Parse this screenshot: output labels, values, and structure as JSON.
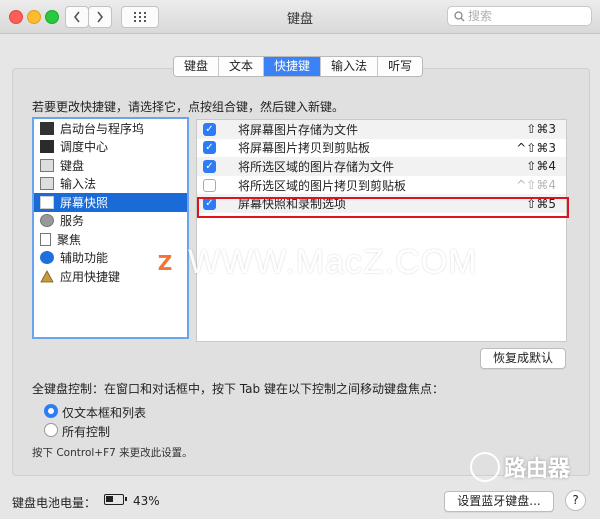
{
  "window": {
    "title": "键盘"
  },
  "search": {
    "placeholder": "搜索"
  },
  "tabs": [
    {
      "label": "键盘",
      "active": false
    },
    {
      "label": "文本",
      "active": false
    },
    {
      "label": "快捷键",
      "active": true
    },
    {
      "label": "输入法",
      "active": false
    },
    {
      "label": "听写",
      "active": false
    }
  ],
  "instruction": "若要更改快捷键，请选择它，点按组合键，然后键入新键。",
  "categories": [
    {
      "label": "启动台与程序坞",
      "icon": "launchpad-icon"
    },
    {
      "label": "调度中心",
      "icon": "mission-control-icon"
    },
    {
      "label": "键盘",
      "icon": "keyboard-icon"
    },
    {
      "label": "输入法",
      "icon": "input-source-icon"
    },
    {
      "label": "屏幕快照",
      "icon": "screenshot-icon",
      "selected": true
    },
    {
      "label": "服务",
      "icon": "gear-icon"
    },
    {
      "label": "聚焦",
      "icon": "spotlight-icon"
    },
    {
      "label": "辅助功能",
      "icon": "accessibility-icon"
    },
    {
      "label": "应用快捷键",
      "icon": "app-shortcut-icon"
    }
  ],
  "shortcuts": [
    {
      "label": "将屏幕图片存储为文件",
      "keys": "⇧⌘3",
      "checked": true
    },
    {
      "label": "将屏幕图片拷贝到剪贴板",
      "keys": "^⇧⌘3",
      "checked": true
    },
    {
      "label": "将所选区域的图片存储为文件",
      "keys": "⇧⌘4",
      "checked": true
    },
    {
      "label": "将所选区域的图片拷贝到剪贴板",
      "keys": "^⇧⌘4",
      "checked": false
    },
    {
      "label": "屏幕快照和录制选项",
      "keys": "⇧⌘5",
      "checked": true
    }
  ],
  "restore_button": "恢复成默认",
  "full_keyboard": {
    "title": "全键盘控制：在窗口和对话框中，按下 Tab 键在以下控制之间移动键盘焦点：",
    "options": [
      {
        "label": "仅文本框和列表",
        "selected": true
      },
      {
        "label": "所有控制",
        "selected": false
      }
    ],
    "note": "按下 Control+F7 来更改此设置。"
  },
  "battery": {
    "label": "键盘电池电量：",
    "percent": "43%",
    "level": 0.43
  },
  "bluetooth_button": "设置蓝牙键盘...",
  "help_button": "?",
  "watermark": {
    "text": "WWW.MacZ.COM",
    "logo": "Z"
  },
  "corner_watermark": {
    "text": "路由器"
  }
}
